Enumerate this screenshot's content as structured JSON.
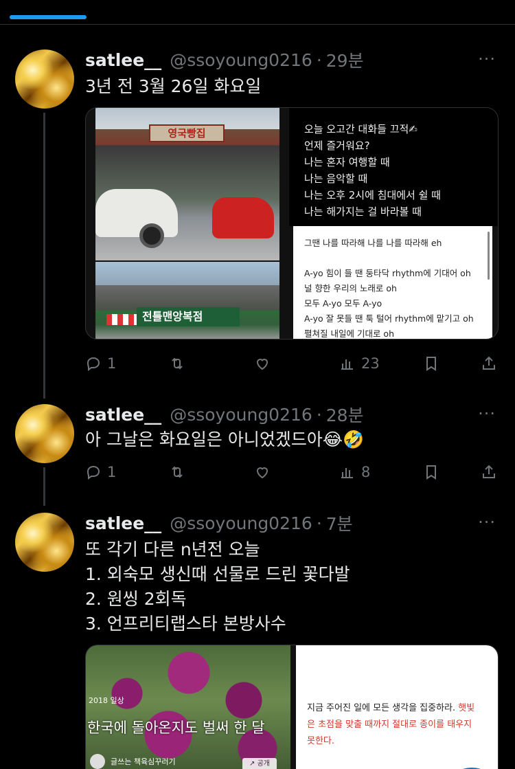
{
  "colors": {
    "background": "#000000",
    "accent": "#1d9bf0",
    "muted": "#71767b",
    "text": "#e7e9ea"
  },
  "tweets": [
    {
      "name": "satlee__",
      "handle": "@ssoyoung0216",
      "separator": "·",
      "time": "29분",
      "more": "···",
      "text": [
        "3년 전 3월 26일 화요일"
      ],
      "media": {
        "store_sign": "영국빵집",
        "street_sign": "전틀맨앙복점",
        "lyrics_top": [
          "오늘 오고간 대화들 끄적✍",
          "언제 즐거워요?",
          "나는 혼자 여행할 때",
          "나는 음악할 때",
          "나는 오후 2시에 침대에서 쉴 때",
          "나는 해가지는 걸 바라볼 때"
        ],
        "lyrics_bottom": [
          "그땐 나를 따라해 나를 나를 따라해 eh",
          "",
          "A-yo 힘이 들 땐 둥타닥 rhythm에 기대어 oh",
          "널 향한 우리의 노래로 oh",
          "모두 A-yo 모두 A-yo",
          "A-yo 잘 못들 땐 툭 털어 rhythm에 맡기고 oh",
          "펼쳐질 내일에 기대로 oh"
        ]
      },
      "stats": {
        "replies": "1",
        "retweets": "",
        "likes": "",
        "views": "23"
      }
    },
    {
      "name": "satlee__",
      "handle": "@ssoyoung0216",
      "separator": "·",
      "time": "28분",
      "more": "···",
      "text": [
        "아 그날은 화요일은 아니었겠드아😂🤣"
      ],
      "stats": {
        "replies": "1",
        "retweets": "",
        "likes": "",
        "views": "8"
      }
    },
    {
      "name": "satlee__",
      "handle": "@ssoyoung0216",
      "separator": "·",
      "time": "7분",
      "more": "···",
      "text": [
        "또 각기 다른 n년전 오늘",
        "1. 외숙모 생신때 선물로 드린 꽃다발",
        "2. 원씽 2회독",
        "3. 언프리티랩스타 본방사수"
      ],
      "media": {
        "tag": "2018 일상",
        "headline": "한국에 돌아온지도 벌써 한 달",
        "channel": "글쓰는 책육심꾸러기",
        "share": "↗ 공개",
        "quote_black": "지금 주어진 일에 모든 생각을 집중하라.",
        "quote_red_1": "햇빛",
        "quote_red_2": "은 초점을 맞출 때까지 절대로 종이를 태우지",
        "quote_red_3": "못한다."
      }
    }
  ]
}
